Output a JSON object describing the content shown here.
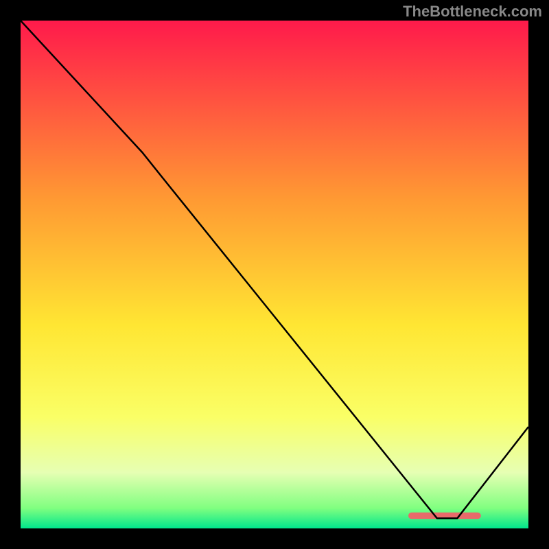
{
  "watermark": "TheBottleneck.com",
  "chart_data": {
    "type": "line",
    "title": "",
    "xlabel": "",
    "ylabel": "",
    "xlim": [
      0,
      100
    ],
    "ylim": [
      0,
      100
    ],
    "background_gradient": {
      "stops": [
        {
          "offset": 0,
          "color": "#ff1a4b"
        },
        {
          "offset": 35,
          "color": "#ff9933"
        },
        {
          "offset": 60,
          "color": "#ffe633"
        },
        {
          "offset": 78,
          "color": "#faff66"
        },
        {
          "offset": 89,
          "color": "#e6ffb3"
        },
        {
          "offset": 96,
          "color": "#80ff80"
        },
        {
          "offset": 100,
          "color": "#00e68c"
        }
      ]
    },
    "series": [
      {
        "name": "bottleneck-curve",
        "color": "#000000",
        "points": [
          {
            "x": 0,
            "y": 100
          },
          {
            "x": 24,
            "y": 74
          },
          {
            "x": 28,
            "y": 69
          },
          {
            "x": 82,
            "y": 2
          },
          {
            "x": 86,
            "y": 2
          },
          {
            "x": 100,
            "y": 20
          }
        ]
      }
    ],
    "marker": {
      "color": "#e86a6a",
      "x_start": 77,
      "x_end": 90,
      "y": 2.5,
      "thickness": 1.3
    }
  }
}
